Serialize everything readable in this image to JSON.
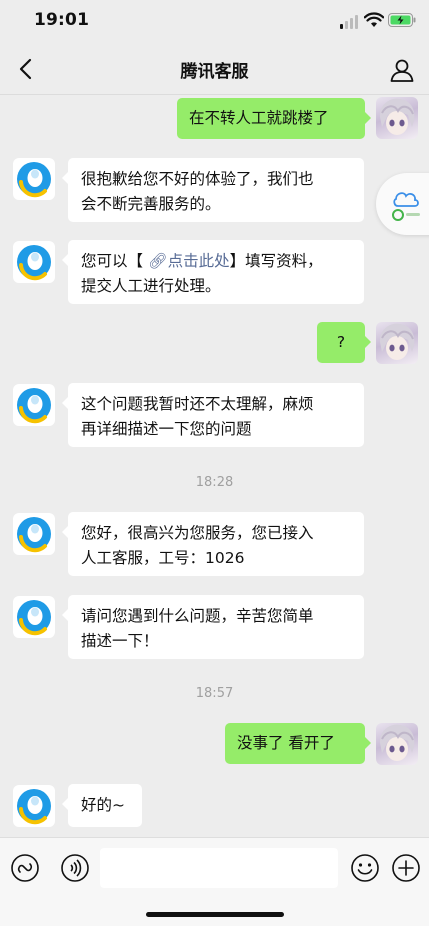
{
  "status_bar": {
    "time": "19:01"
  },
  "header": {
    "title": "腾讯客服",
    "back_icon": "chevron-left-icon",
    "profile_icon": "person-icon"
  },
  "messages": [
    {
      "side": "right",
      "text": "在不转人工就跳楼了"
    },
    {
      "side": "left",
      "lines": [
        "很抱歉给您不好的体验了，我们也",
        "会不断完善服务的。"
      ]
    },
    {
      "side": "left",
      "line1_prefix": "您可以【",
      "link_text": "点击此处",
      "line1_suffix": "】填写资料，",
      "line2": "提交人工进行处理。"
    },
    {
      "side": "right",
      "text": "?"
    },
    {
      "side": "left",
      "lines": [
        "这个问题我暂时还不太理解，麻烦",
        "再详细描述一下您的问题"
      ]
    },
    {
      "side": "left",
      "lines": [
        "您好，很高兴为您服务，您已接入",
        "人工客服，工号：1026"
      ]
    },
    {
      "side": "left",
      "lines": [
        "请问您遇到什么问题，辛苦您简单",
        "描述一下！"
      ]
    },
    {
      "side": "right",
      "text": "没事了 看开了"
    },
    {
      "side": "left",
      "lines": [
        "好的~"
      ]
    }
  ],
  "timestamps": [
    "18:28",
    "18:57"
  ],
  "input_bar": {
    "value": "",
    "icons": [
      "mini-program-icon",
      "voice-icon",
      "emoji-icon",
      "plus-icon"
    ]
  },
  "colors": {
    "background": "#ededed",
    "self_bubble": "#95ec69",
    "bot_bubble": "#ffffff",
    "link": "#576b95"
  }
}
